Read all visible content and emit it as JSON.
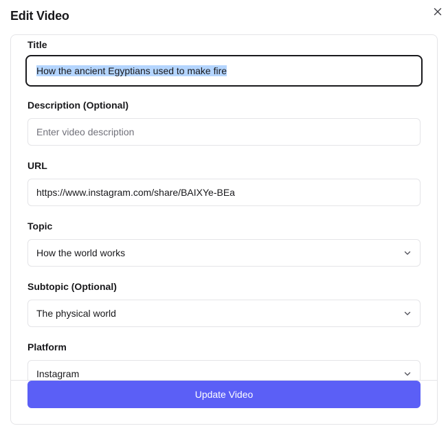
{
  "dialog": {
    "title": "Edit Video",
    "close_icon": "close-icon"
  },
  "form": {
    "title": {
      "label": "Title",
      "value": "How the ancient Egyptians used to make fire"
    },
    "description": {
      "label": "Description (Optional)",
      "value": "",
      "placeholder": "Enter video description"
    },
    "url": {
      "label": "URL",
      "value": "https://www.instagram.com/share/BAIXYe-BEa"
    },
    "topic": {
      "label": "Topic",
      "value": "How the world works"
    },
    "subtopic": {
      "label": "Subtopic (Optional)",
      "value": "The physical world"
    },
    "platform": {
      "label": "Platform",
      "value": "Instagram"
    },
    "submit_label": "Update Video"
  },
  "colors": {
    "accent": "#5b5ff6",
    "text_selection": "#b4d5fe",
    "border": "#e4e4e7",
    "focus_border": "#18181b"
  }
}
